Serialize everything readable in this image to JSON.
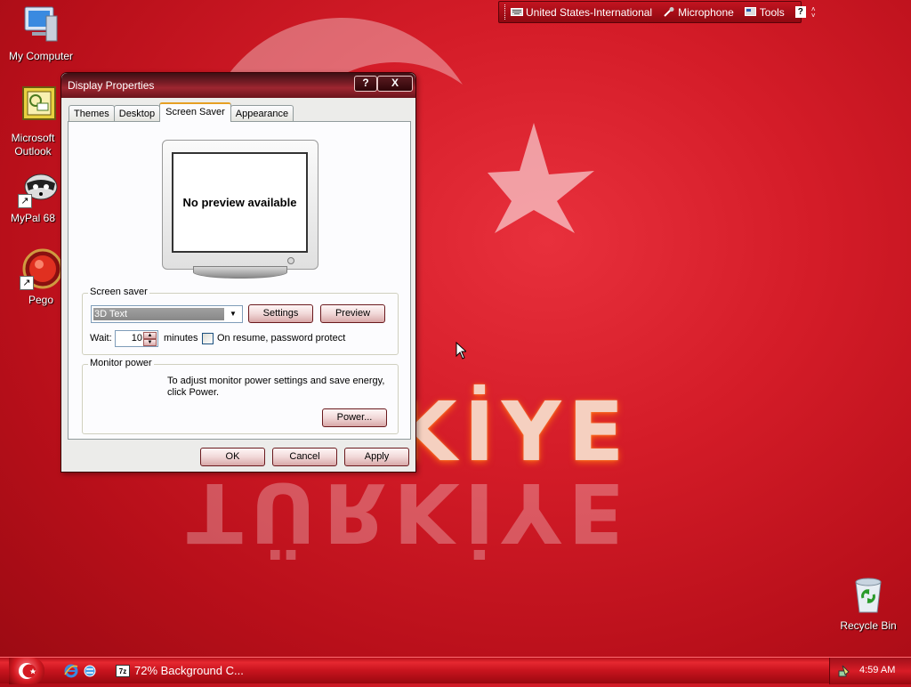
{
  "desktop": {
    "icons": [
      {
        "label": "My Computer"
      },
      {
        "label": "Microsoft Outlook"
      },
      {
        "label": "MyPal 68"
      },
      {
        "label": "Pego"
      },
      {
        "label": "Recycle Bin"
      }
    ],
    "wallpaper_text": "TÜRKİYE",
    "wallpaper_reflection": "TÜRKİYE"
  },
  "langbar": {
    "language": "United States-International",
    "microphone": "Microphone",
    "tools": "Tools",
    "help": "?"
  },
  "window": {
    "title": "Display Properties",
    "help_button": "?",
    "close_button": "X",
    "tabs": [
      "Themes",
      "Desktop",
      "Screen Saver",
      "Appearance"
    ],
    "active_tab": "Screen Saver",
    "preview_text": "No preview available",
    "screen_saver": {
      "group_title": "Screen saver",
      "selected": "3D Text",
      "settings_label": "Settings",
      "preview_label": "Preview",
      "wait_label": "Wait:",
      "wait_value": "10",
      "minutes_label": "minutes",
      "password_protect_label": "On resume, password protect",
      "password_protect_checked": false
    },
    "monitor_power": {
      "group_title": "Monitor power",
      "description": "To adjust monitor power settings and save energy, click Power.",
      "power_label": "Power..."
    },
    "buttons": {
      "ok": "OK",
      "cancel": "Cancel",
      "apply": "Apply"
    }
  },
  "taskbar": {
    "task_item": "72% Background C...",
    "task_icon_text": "7z",
    "clock": "4:59 AM"
  },
  "colors": {
    "desktop_red": "#d41c28",
    "taskbar_red": "#c8141e",
    "tab_highlight": "#e6a024"
  }
}
